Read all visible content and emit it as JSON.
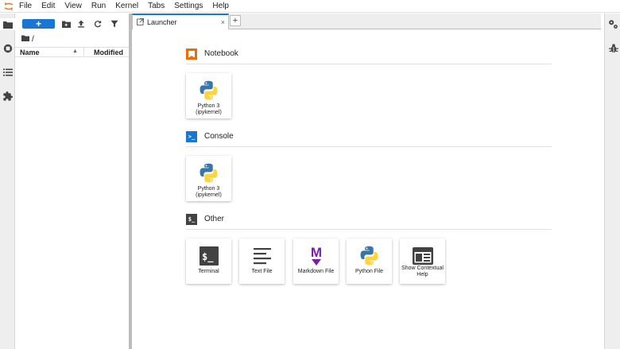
{
  "menu": [
    "File",
    "Edit",
    "View",
    "Run",
    "Kernel",
    "Tabs",
    "Settings",
    "Help"
  ],
  "filebrowser": {
    "new_button_label": "+",
    "breadcrumb": "/",
    "columns": {
      "name": "Name",
      "modified": "Modified"
    }
  },
  "tabs": [
    {
      "label": "Launcher",
      "close": "×"
    }
  ],
  "add_tab_label": "+",
  "launcher": {
    "sections": [
      {
        "title": "Notebook",
        "icon": "notebook-icon",
        "cards": [
          {
            "label": "Python 3 (ipykernel)",
            "icon": "python-icon"
          }
        ]
      },
      {
        "title": "Console",
        "icon": "console-icon",
        "cards": [
          {
            "label": "Python 3 (ipykernel)",
            "icon": "python-icon"
          }
        ]
      },
      {
        "title": "Other",
        "icon": "other-icon",
        "cards": [
          {
            "label": "Terminal",
            "icon": "terminal-icon"
          },
          {
            "label": "Text File",
            "icon": "text-file-icon"
          },
          {
            "label": "Markdown File",
            "icon": "markdown-icon"
          },
          {
            "label": "Python File",
            "icon": "python-icon"
          },
          {
            "label": "Show Contextual Help",
            "icon": "contextual-help-icon"
          }
        ]
      }
    ]
  },
  "console_icon_glyph": ">_",
  "other_icon_glyph": "$_",
  "colors": {
    "accent": "#1976d2",
    "notebook": "#ef6c00",
    "markdown": "#7b1fa2",
    "python_blue": "#3776ab",
    "python_yellow": "#ffd43b"
  }
}
